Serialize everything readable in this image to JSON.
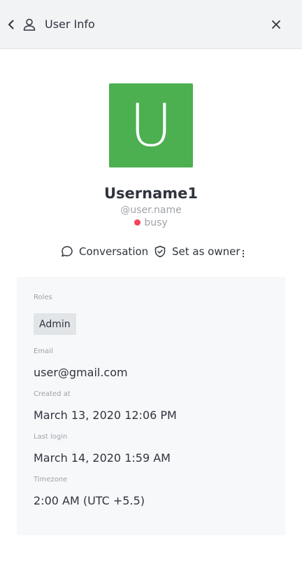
{
  "header": {
    "title": "User Info",
    "back_icon": "chevron-left-icon",
    "user_icon": "user-icon",
    "close_icon": "close-icon"
  },
  "profile": {
    "avatar_letter": "U",
    "avatar_color": "#4caf50",
    "username": "Username1",
    "handle": "@user.name",
    "status": "busy",
    "status_color": "#f5455c"
  },
  "actions": {
    "conversation_label": "Conversation",
    "set_owner_label": "Set as owner",
    "more_icon": "kebab-icon"
  },
  "info": {
    "roles_label": "Roles",
    "roles": [
      "Admin"
    ],
    "email_label": "Email",
    "email": "user@gmail.com",
    "created_label": "Created at",
    "created": "March 13, 2020 12:06 PM",
    "last_login_label": "Last login",
    "last_login": "March 14, 2020 1:59 AM",
    "timezone_label": "Timezone",
    "timezone": "2:00 AM (UTC +5.5)"
  }
}
